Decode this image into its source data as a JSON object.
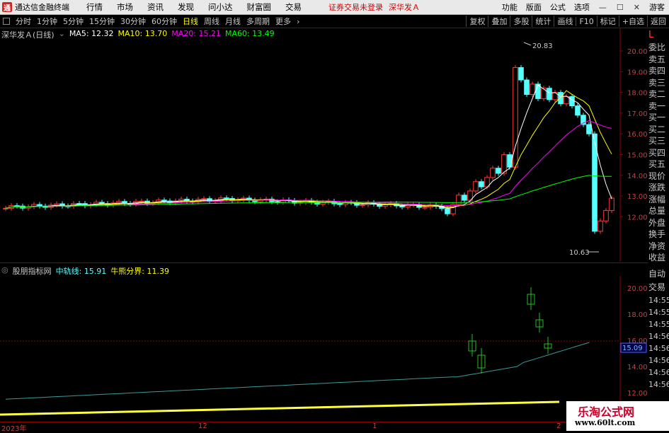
{
  "menubar": {
    "app_title": "通达信金融终端",
    "menus": [
      "行情",
      "市场",
      "资讯",
      "发现",
      "问小达",
      "财富圈",
      "交易"
    ],
    "warning": "证券交易未登录",
    "stock": "深华发Ａ",
    "right_items": [
      "功能",
      "版面",
      "公式",
      "选项"
    ],
    "user": "游客",
    "logo_text": "通"
  },
  "toolbar": {
    "periods": [
      "分时",
      "1分钟",
      "5分钟",
      "15分钟",
      "30分钟",
      "60分钟",
      "日线",
      "周线",
      "月线",
      "多周期",
      "更多"
    ],
    "active": "日线",
    "right_buttons": [
      "复权",
      "叠加",
      "多股",
      "统计",
      "画线",
      "F10",
      "标记",
      "+自选",
      "返回"
    ]
  },
  "main_chart": {
    "title": "深华发Ａ(日线)",
    "ma5": "MA5: 12.32",
    "ma10": "MA10: 13.70",
    "ma20": "MA20: 15.21",
    "ma60": "MA60: 13.49",
    "colors": {
      "ma5": "#ffffff",
      "ma10": "#ffff00",
      "ma20": "#ff00ff",
      "ma60": "#00ff00",
      "up": "#ff3a3a",
      "down": "#54ffff"
    },
    "high_label": "20.83",
    "low_label": "10.63",
    "y_ticks": [
      "20.00",
      "19.00",
      "18.00",
      "17.00",
      "16.00",
      "15.00",
      "14.00",
      "13.00",
      "12.00"
    ]
  },
  "sub_chart": {
    "title": "股朋指标网",
    "mid_label": "中轨线: 15.91",
    "bull_label": "牛熊分界: 11.39",
    "value_box": "15.09",
    "y_ticks": [
      "20.00",
      "18.00",
      "16.00",
      "14.00",
      "12.00"
    ]
  },
  "right_panel": {
    "top_marker": "L",
    "items": [
      "委比",
      "卖五",
      "卖四",
      "卖三",
      "卖二",
      "卖一",
      "买一",
      "买二",
      "买三",
      "买四",
      "买五",
      "现价",
      "涨跌",
      "涨幅",
      "总量",
      "外盘",
      "换手",
      "净资",
      "收益"
    ],
    "lower_items": [
      "自动",
      "交易"
    ],
    "times": [
      "14:55",
      "14:55",
      "14:55",
      "14:56",
      "14:56",
      "14:56",
      "14:56",
      "14:56"
    ]
  },
  "date_axis": {
    "labels": [
      "2023年",
      "12",
      "1",
      "2"
    ]
  },
  "watermark": {
    "line1": "乐淘公式网",
    "line2": "www.60lt.com"
  }
}
